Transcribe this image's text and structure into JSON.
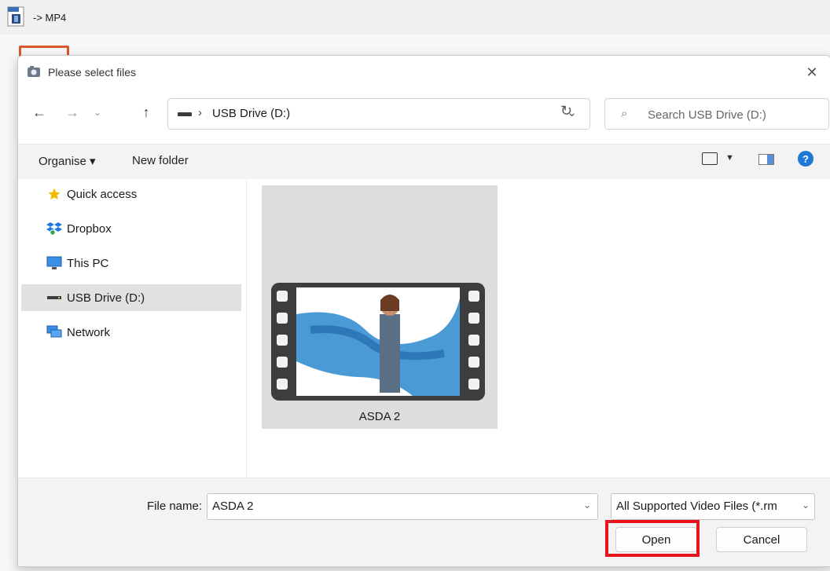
{
  "app": {
    "title": "-> MP4",
    "icon": "mp4-file-icon"
  },
  "dialog": {
    "title": "Please select files",
    "close_icon": "close-icon",
    "nav": {
      "back_icon": "arrow-left-icon",
      "forward_icon": "arrow-right-icon",
      "recent_icon": "chevron-down-icon",
      "up_icon": "arrow-up-icon"
    },
    "address": {
      "path": "USB Drive (D:)",
      "separator": "›"
    },
    "search": {
      "placeholder": "Search USB Drive (D:)"
    },
    "toolbar": {
      "organise_label": "Organise ▾",
      "new_folder_label": "New folder",
      "help_label": "?"
    },
    "sidebar": {
      "items": [
        {
          "label": "Quick access",
          "icon": "star-icon",
          "selected": false
        },
        {
          "label": "Dropbox",
          "icon": "dropbox-icon",
          "selected": false
        },
        {
          "label": "This PC",
          "icon": "monitor-icon",
          "selected": false
        },
        {
          "label": "USB Drive (D:)",
          "icon": "usb-drive-icon",
          "selected": true
        },
        {
          "label": "Network",
          "icon": "network-icon",
          "selected": false
        }
      ]
    },
    "files": [
      {
        "name": "ASDA 2",
        "type": "video"
      }
    ],
    "footer": {
      "file_name_label": "File name:",
      "file_name_value": "ASDA 2",
      "file_type_value": "All Supported Video Files (*.rm",
      "open_label": "Open",
      "cancel_label": "Cancel"
    }
  },
  "colors": {
    "accent_blue": "#1e78d6",
    "highlight_red": "#e8141c",
    "selection_bg": "#e1e1e1"
  }
}
